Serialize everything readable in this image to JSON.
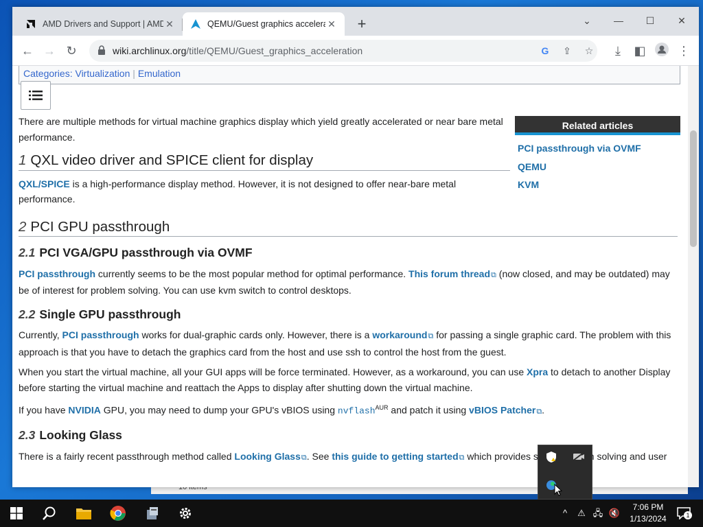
{
  "browser": {
    "tabs": [
      {
        "title": "AMD Drivers and Support | AMD",
        "icon": "amd-logo-icon",
        "active": false
      },
      {
        "title": "QEMU/Guest graphics acceleratio",
        "icon": "archlinux-logo-icon",
        "active": true
      }
    ],
    "url_host": "wiki.archlinux.org",
    "url_path": "/title/QEMU/Guest_graphics_acceleration"
  },
  "page": {
    "categories_label": "Categories:",
    "categories": [
      "Virtualization",
      "Emulation"
    ],
    "intro": "There are multiple methods for virtual machine graphics display which yield greatly accelerated or near bare metal performance.",
    "related": {
      "heading": "Related articles",
      "items": [
        "PCI passthrough via OVMF",
        "QEMU",
        "KVM"
      ]
    },
    "s1": {
      "num": "1",
      "title": "QXL video driver and SPICE client for display",
      "link": "QXL/SPICE",
      "text": " is a high-performance display method. However, it is not designed to offer near-bare metal performance."
    },
    "s2": {
      "num": "2",
      "title": "PCI GPU passthrough"
    },
    "s21": {
      "num": "2.1",
      "title": "PCI VGA/GPU passthrough via OVMF",
      "link1": "PCI passthrough",
      "t1": " currently seems to be the most popular method for optimal performance. ",
      "link2": "This forum thread",
      "t2": " (now closed, and may be outdated) may be of interest for problem solving. You can use kvm switch to control desktops."
    },
    "s22": {
      "num": "2.2",
      "title": "Single GPU passthrough",
      "p1_a": "Currently, ",
      "p1_link1": "PCI passthrough",
      "p1_b": " works for dual-graphic cards only. However, there is a ",
      "p1_link2": "workaround",
      "p1_c": " for passing a single graphic card. The problem with this approach is that you have to detach the graphics card from the host and use ssh to control the host from the guest.",
      "p2_a": "When you start the virtual machine, all your GUI apps will be force terminated. However, as a workaround, you can use ",
      "p2_link": "Xpra",
      "p2_b": " to detach to another Display before starting the virtual machine and reattach the Apps to display after shutting down the virtual machine.",
      "p3_a": "If you have ",
      "p3_link1": "NVIDIA",
      "p3_b": " GPU, you may need to dump your GPU's vBIOS using ",
      "p3_code": "nvflash",
      "p3_sup": "AUR",
      "p3_c": " and patch it using ",
      "p3_link2": "vBIOS Patcher",
      "p3_d": "."
    },
    "s23": {
      "num": "2.3",
      "title": "Looking Glass",
      "a": "There is a fairly recent passthrough method called ",
      "link1": "Looking Glass",
      "b": ". See ",
      "link2": "this guide to getting started",
      "c": " which provides some problem solving and user"
    }
  },
  "explorer": {
    "status": "10 items"
  },
  "taskbar": {
    "time": "7:06 PM",
    "date": "1/13/2024",
    "notification_count": "1"
  },
  "colors": {
    "link": "#1f6fa8",
    "related_head_bg": "#333333",
    "related_head_accent": "#1793d1",
    "taskbar": "#101010"
  }
}
